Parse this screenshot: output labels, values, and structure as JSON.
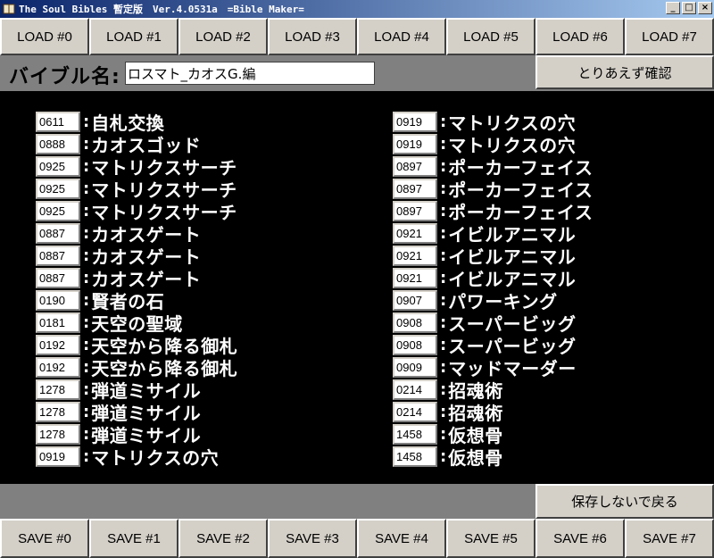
{
  "window": {
    "title": "The Soul Bibles 暫定版　Ver.4.0531a　=Bible Maker=",
    "controls": {
      "minimize": "_",
      "restore": "□",
      "close": "×"
    }
  },
  "load_buttons": [
    "LOAD #0",
    "LOAD #1",
    "LOAD #2",
    "LOAD #3",
    "LOAD #4",
    "LOAD #5",
    "LOAD #6",
    "LOAD #7"
  ],
  "save_buttons": [
    "SAVE #0",
    "SAVE #1",
    "SAVE #2",
    "SAVE #3",
    "SAVE #4",
    "SAVE #5",
    "SAVE #6",
    "SAVE #7"
  ],
  "bible": {
    "name_label": "バイブル名",
    "name_colon": ":",
    "name_value": "ロスマト_カオスG.編",
    "confirm_label": "とりあえず確認",
    "back_label": "保存しないで戻る"
  },
  "separator": ":",
  "cards_left": [
    {
      "id": "0611",
      "name": "自札交換"
    },
    {
      "id": "0888",
      "name": "カオスゴッド"
    },
    {
      "id": "0925",
      "name": "マトリクスサーチ"
    },
    {
      "id": "0925",
      "name": "マトリクスサーチ"
    },
    {
      "id": "0925",
      "name": "マトリクスサーチ"
    },
    {
      "id": "0887",
      "name": "カオスゲート"
    },
    {
      "id": "0887",
      "name": "カオスゲート"
    },
    {
      "id": "0887",
      "name": "カオスゲート"
    },
    {
      "id": "0190",
      "name": "賢者の石"
    },
    {
      "id": "0181",
      "name": "天空の聖域"
    },
    {
      "id": "0192",
      "name": "天空から降る御札"
    },
    {
      "id": "0192",
      "name": "天空から降る御札"
    },
    {
      "id": "1278",
      "name": "弾道ミサイル"
    },
    {
      "id": "1278",
      "name": "弾道ミサイル"
    },
    {
      "id": "1278",
      "name": "弾道ミサイル"
    },
    {
      "id": "0919",
      "name": "マトリクスの穴"
    }
  ],
  "cards_right": [
    {
      "id": "0919",
      "name": "マトリクスの穴"
    },
    {
      "id": "0919",
      "name": "マトリクスの穴"
    },
    {
      "id": "0897",
      "name": "ポーカーフェイス"
    },
    {
      "id": "0897",
      "name": "ポーカーフェイス"
    },
    {
      "id": "0897",
      "name": "ポーカーフェイス"
    },
    {
      "id": "0921",
      "name": "イビルアニマル"
    },
    {
      "id": "0921",
      "name": "イビルアニマル"
    },
    {
      "id": "0921",
      "name": "イビルアニマル"
    },
    {
      "id": "0907",
      "name": "パワーキング"
    },
    {
      "id": "0908",
      "name": "スーパービッグ"
    },
    {
      "id": "0908",
      "name": "スーパービッグ"
    },
    {
      "id": "0909",
      "name": "マッドマーダー"
    },
    {
      "id": "0214",
      "name": "招魂術"
    },
    {
      "id": "0214",
      "name": "招魂術"
    },
    {
      "id": "1458",
      "name": "仮想骨"
    },
    {
      "id": "1458",
      "name": "仮想骨"
    }
  ]
}
